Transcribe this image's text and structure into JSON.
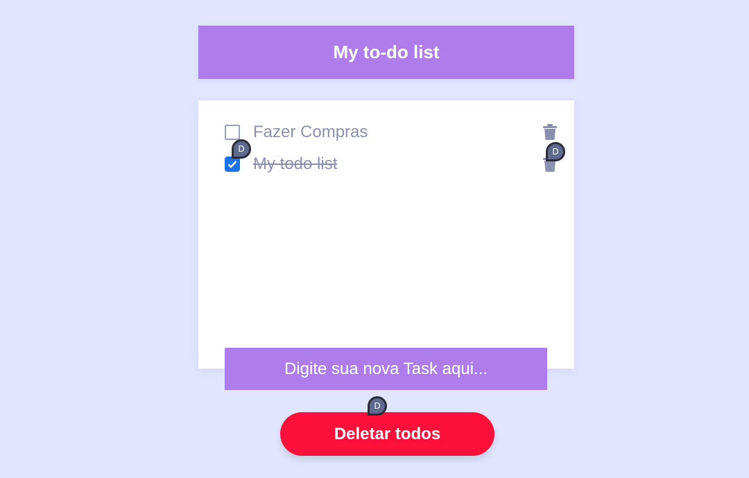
{
  "header": {
    "title": "My to-do list"
  },
  "todos": [
    {
      "label": "Fazer Compras",
      "completed": false,
      "delete_icon": "trash-icon"
    },
    {
      "label": "My todo list",
      "completed": true,
      "delete_icon": "trash-icon"
    }
  ],
  "new_task": {
    "placeholder": "Digite sua nova Task aqui...",
    "value": ""
  },
  "actions": {
    "delete_all_label": "Deletar todos"
  },
  "cursors": [
    {
      "initial": "D"
    },
    {
      "initial": "D"
    },
    {
      "initial": "D"
    }
  ],
  "colors": {
    "background": "#e1e6fe",
    "accent": "#ae7deb",
    "danger": "#fd1039",
    "checkbox_checked": "#1a73e8",
    "text_muted": "#8b90ad"
  }
}
